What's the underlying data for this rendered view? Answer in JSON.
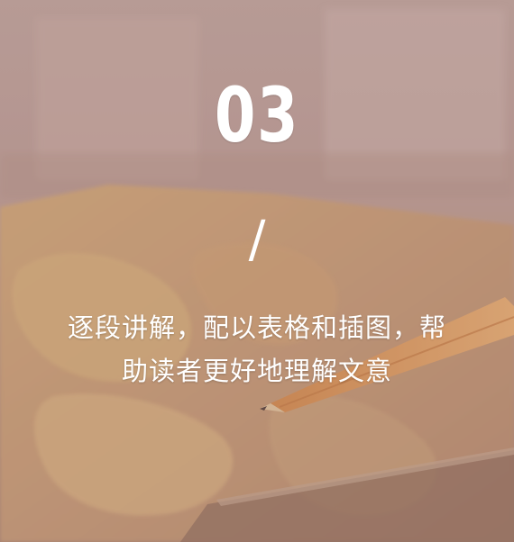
{
  "number": "03",
  "separator": "/",
  "caption": {
    "line1": "逐段讲解，配以表格和插图，帮",
    "line2": "助读者更好地理解文意"
  },
  "colors": {
    "overlay": "#c9a79f",
    "text": "#ffffff",
    "map_land": "#d9b07a",
    "pencil": "#e8a15a"
  }
}
